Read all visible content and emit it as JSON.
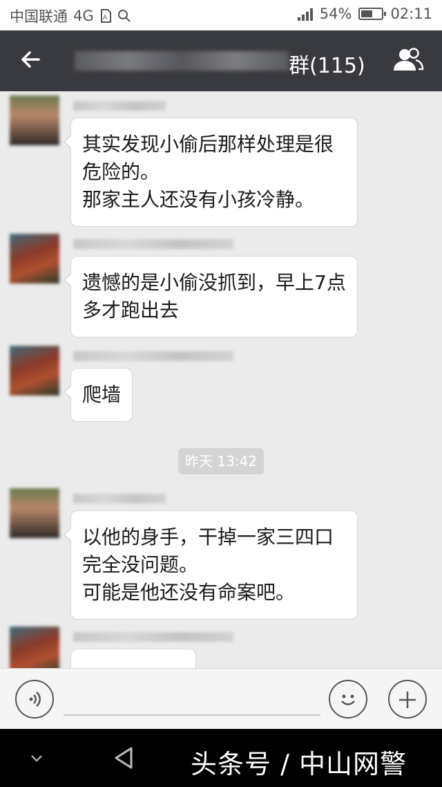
{
  "status_bar": {
    "carrier": "中国联通",
    "network": "4G",
    "battery": "54%",
    "time": "02:11"
  },
  "header": {
    "back_icon": "arrow-left-icon",
    "group_name_visible": "群(115)",
    "members_icon": "group-members-icon"
  },
  "messages": [
    {
      "text": "其实发现小偷后那样处理是很\n危险的。\n那家主人还没有小孩冷静。"
    },
    {
      "text": "遗憾的是小偷没抓到，早上7点\n多才跑出去"
    },
    {
      "text": "爬墙"
    },
    {
      "text": "以他的身手，干掉一家三四口\n完全没问题。\n可能是他还没有命案吧。"
    }
  ],
  "time_separator": "昨天 13:42",
  "input_bar": {
    "voice_icon": "voice-icon",
    "emoji_icon": "emoji-icon",
    "plus_icon": "plus-icon"
  },
  "watermark": "头条号 / 中山网警",
  "colors": {
    "title_bar": "#393a3f",
    "chat_background": "#ebebeb",
    "bubble": "#ffffff"
  }
}
